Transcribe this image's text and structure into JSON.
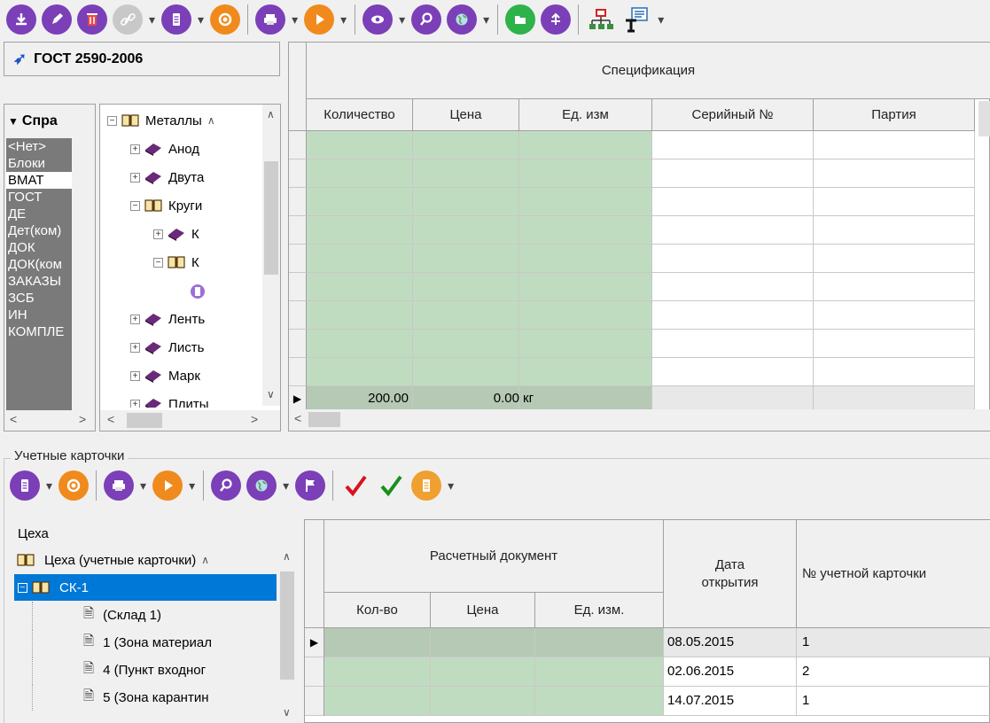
{
  "toolbar_top": {
    "icons": [
      "download-icon",
      "edit-icon",
      "delete-icon",
      "link-icon",
      "document-icon",
      "refresh-icon",
      "print-icon",
      "play-icon",
      "view-icon",
      "search-icon",
      "globe-icon",
      "folder-icon",
      "attach-icon",
      "network-icon",
      "field-icon"
    ]
  },
  "left_panel": {
    "title": "ГОСТ 2590-2006",
    "dropdown_label": "Спра",
    "list": [
      "<Нет>",
      "Блоки",
      "ВМАТ",
      "ГОСТ",
      "ДЕ",
      "Дет(ком)",
      "ДОК",
      "ДОК(ком",
      "ЗАКАЗЫ",
      "ЗСБ",
      "ИН",
      "КОМПЛЕ"
    ],
    "selected_index": 2
  },
  "tree": {
    "items": [
      {
        "label": "Металлы",
        "level": 0,
        "expander": "minus",
        "icon": "open-book"
      },
      {
        "label": "Анод",
        "level": 1,
        "expander": "plus",
        "icon": "closed-book"
      },
      {
        "label": "Двута",
        "level": 1,
        "expander": "plus",
        "icon": "closed-book"
      },
      {
        "label": "Круги",
        "level": 1,
        "expander": "minus",
        "icon": "open-book"
      },
      {
        "label": "К",
        "level": 2,
        "expander": "plus",
        "icon": "closed-book"
      },
      {
        "label": "К",
        "level": 2,
        "expander": "minus",
        "icon": "open-book"
      },
      {
        "label": "",
        "level": 3,
        "expander": "",
        "icon": "item"
      },
      {
        "label": "Ленть",
        "level": 1,
        "expander": "plus",
        "icon": "closed-book"
      },
      {
        "label": "Листь",
        "level": 1,
        "expander": "plus",
        "icon": "closed-book"
      },
      {
        "label": "Марк",
        "level": 1,
        "expander": "plus",
        "icon": "closed-book"
      },
      {
        "label": "Плиты",
        "level": 1,
        "expander": "plus",
        "icon": "closed-book"
      }
    ]
  },
  "spec_grid": {
    "group_header": "Спецификация",
    "columns": [
      "Количество",
      "Цена",
      "Ед. изм",
      "Серийный №",
      "Партия"
    ],
    "summary": {
      "qty": "200.00",
      "price": "0.00",
      "unit": "кг"
    }
  },
  "bottom": {
    "section_title": "Учетные карточки",
    "toolbar_icons": [
      "document-icon",
      "refresh-icon",
      "print-icon",
      "play-icon",
      "search-icon",
      "globe-icon",
      "flag-icon",
      "check-red-icon",
      "check-green-icon",
      "note-icon"
    ],
    "shops_label": "Цеха",
    "shops_tree": [
      {
        "label": "Цеха (учетные карточки)",
        "level": 0
      },
      {
        "label": "СК-1",
        "level": 0,
        "selected": true
      },
      {
        "label": " (Склад 1)",
        "level": 1
      },
      {
        "label": "1 (Зона материал",
        "level": 1
      },
      {
        "label": "4 (Пункт входног",
        "level": 1
      },
      {
        "label": "5 (Зона карантин",
        "level": 1
      }
    ],
    "cards_grid": {
      "group_header": "Расчетный документ",
      "sub_columns": [
        "Кол-во",
        "Цена",
        "Ед. изм."
      ],
      "date_header": "Дата открытия",
      "card_header": "№ учетной карточки",
      "rows": [
        {
          "date": "08.05.2015",
          "card": "1"
        },
        {
          "date": "02.06.2015",
          "card": "2"
        },
        {
          "date": "14.07.2015",
          "card": "1"
        }
      ]
    }
  },
  "colors": {
    "accent": "#7b3fb8",
    "orange": "#f08a1c",
    "selection": "#0078d7",
    "green_cell": "#c0dcc0",
    "list_bg": "#7a7a7a"
  }
}
